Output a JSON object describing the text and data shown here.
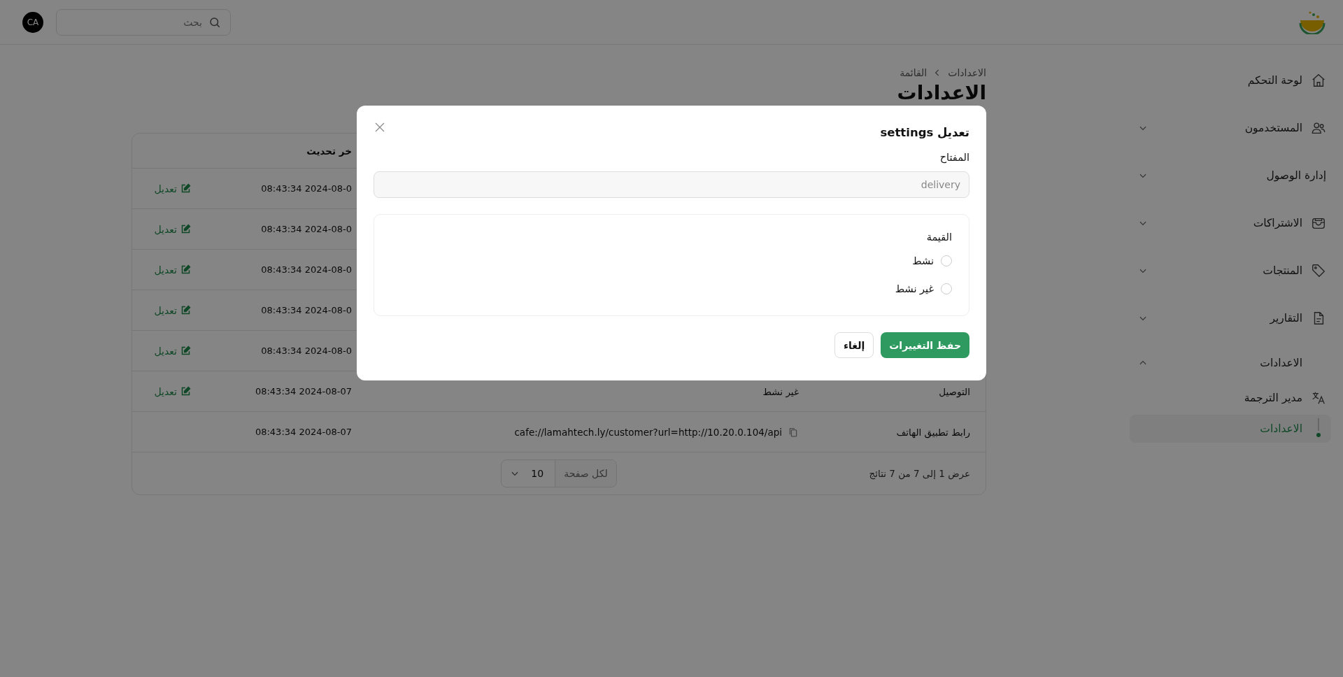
{
  "topbar": {
    "search": {
      "placeholder": "بحث"
    },
    "avatar": "CA"
  },
  "sidebar": {
    "items": [
      {
        "label": "لوحة التحكم",
        "kind": "link"
      },
      {
        "label": "المستخدمون",
        "kind": "group",
        "expanded": false
      },
      {
        "label": "إدارة الوصول",
        "kind": "group",
        "expanded": false
      },
      {
        "label": "الاشتراكات",
        "kind": "group",
        "expanded": false
      },
      {
        "label": "المنتجات",
        "kind": "group",
        "expanded": false
      },
      {
        "label": "التقارير",
        "kind": "group",
        "expanded": false
      },
      {
        "label": "الاعدادات",
        "kind": "group",
        "expanded": true,
        "children": [
          {
            "label": "مدير الترجمة",
            "selected": false
          },
          {
            "label": "الاعدادات",
            "selected": true
          }
        ]
      }
    ]
  },
  "breadcrumb": [
    "الاعدادات",
    "القائمة"
  ],
  "page_title": "الاعدادات",
  "table": {
    "header_updated": "خر تحديث",
    "rows": [
      {
        "updated": "08:43:34 2024-08-0",
        "action": "تعديل"
      },
      {
        "updated": "08:43:34 2024-08-0",
        "action": "تعديل"
      },
      {
        "updated": "08:43:34 2024-08-0",
        "action": "تعديل"
      },
      {
        "updated": "08:43:34 2024-08-0",
        "action": "تعديل"
      },
      {
        "updated": "08:43:34 2024-08-0",
        "action": "تعديل"
      },
      {
        "key": "التوصيل",
        "value": "غير نشط",
        "updated": "08:43:34 2024-08-07",
        "action": "تعديل"
      },
      {
        "key": "رابط تطبيق الهاتف",
        "value": "cafe://lamahtech.ly/customer?url=http://10.20.0.104/api",
        "copyable": true,
        "updated": "08:43:34 2024-08-07"
      }
    ],
    "summary": "عرض 1 إلى 7 من 7 نتائج",
    "per_page": {
      "label": "لكل صفحة",
      "value": "10"
    }
  },
  "modal": {
    "title": "تعديل settings",
    "key_label": "المفتاح",
    "key_value": "delivery",
    "value_label": "القيمة",
    "options": [
      {
        "label": "نشط",
        "selected": false
      },
      {
        "label": "غير نشط",
        "selected": false
      }
    ],
    "buttons": [
      {
        "label": "حفظ التغييرات",
        "kind": "primary"
      },
      {
        "label": "إلغاء",
        "kind": "secondary"
      }
    ]
  }
}
